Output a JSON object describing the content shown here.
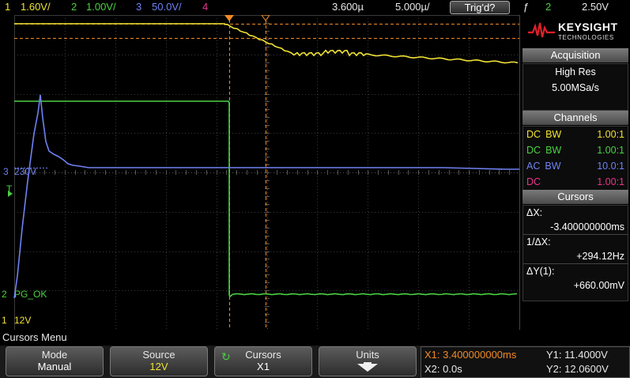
{
  "topbar": {
    "ch1_num": "1",
    "ch1_scale": "1.60V/",
    "ch2_num": "2",
    "ch2_scale": "1.00V/",
    "ch3_num": "3",
    "ch3_scale": "50.0V/",
    "ch4_num": "4",
    "time_delay": "3.600µ",
    "time_scale": "5.000µ/",
    "trigger_status": "Trig'd?",
    "trigger_symbol": "ƒ",
    "trigger_channel": "2",
    "trigger_level": "2.50V"
  },
  "screen_labels": {
    "ch3_marker": "3",
    "ch3_offset": "230V",
    "trig_marker": "T",
    "ch2_marker": "2",
    "ch2_label": "PG_OK",
    "ch1_marker": "1",
    "ch1_label": "12V"
  },
  "panel": {
    "brand": "KEYSIGHT",
    "brand_sub": "TECHNOLOGIES",
    "acquisition": {
      "title": "Acquisition",
      "mode": "High Res",
      "rate": "5.00MSa/s"
    },
    "channels": {
      "title": "Channels",
      "rows": [
        {
          "coupling": "DC",
          "bw": "BW",
          "ratio": "1.00:1",
          "color": "#f0e234"
        },
        {
          "coupling": "DC",
          "bw": "BW",
          "ratio": "1.00:1",
          "color": "#4bd142"
        },
        {
          "coupling": "AC",
          "bw": "BW",
          "ratio": "10.0:1",
          "color": "#6f82f2"
        },
        {
          "coupling": "DC",
          "bw": "",
          "ratio": "1.00:1",
          "color": "#e7358a"
        }
      ]
    },
    "cursors": {
      "title": "Cursors",
      "dx_label": "ΔX:",
      "dx_value": "-3.400000000ms",
      "inv_dx_label": "1/ΔX:",
      "inv_dx_value": "+294.12Hz",
      "dy_label": "ΔY(1):",
      "dy_value": "+660.00mV"
    }
  },
  "menu": {
    "title": "Cursors Menu",
    "mode": {
      "label": "Mode",
      "value": "Manual"
    },
    "source": {
      "label": "Source",
      "value": "12V"
    },
    "cursors": {
      "label": "Cursors",
      "value": "X1"
    },
    "units": {
      "label": "Units"
    }
  },
  "cursor_readout": {
    "x1": "X1: 3.400000000ms",
    "x2": "X2: 0.0s",
    "y1": "Y1: 11.4000V",
    "y2": "Y2: 12.0600V"
  },
  "colors": {
    "ch1": "#f0e234",
    "ch2": "#4bd142",
    "ch3": "#6f82f2",
    "ch4": "#e7358a",
    "cursor": "#f08a24",
    "grid": "#3a3a3a"
  }
}
